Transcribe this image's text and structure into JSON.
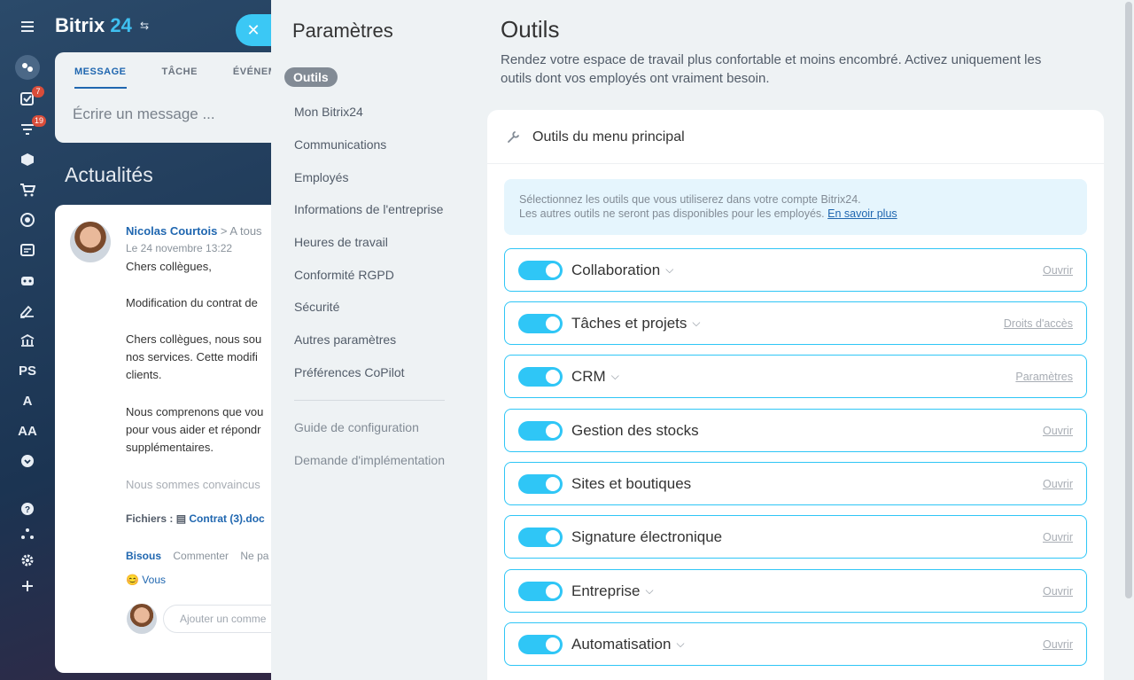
{
  "app": {
    "brand_name": "Bitrix",
    "brand_number": "24",
    "rail_badges": [
      "7",
      "19"
    ],
    "rail_text_items": [
      "PS",
      "A",
      "AA"
    ],
    "icons": [
      "menu-icon",
      "pulse-icon",
      "tasks-icon",
      "filter-icon",
      "box-icon",
      "cart-icon",
      "target-icon",
      "contact-card-icon",
      "robot-icon",
      "signature-icon",
      "bank-icon",
      "chevron-circle-icon",
      "help-icon",
      "structure-icon",
      "gear-icon",
      "plus-icon"
    ]
  },
  "feed": {
    "tabs": [
      "MESSAGE",
      "TÂCHE",
      "ÉVÉNEM"
    ],
    "compose_placeholder": "Écrire un message ...",
    "title": "Actualités",
    "post": {
      "author": "Nicolas Courtois",
      "destination": "A tous",
      "date": "Le 24 novembre 13:22",
      "lines": [
        "Chers collègues,",
        "Modification du contrat de",
        "Chers collègues, nous sou",
        "nos services. Cette modifi",
        "clients.",
        "Nous comprenons que vou",
        "pour vous aider et répondr",
        "supplémentaires.",
        "Nous sommes convaincus"
      ],
      "files_label": "Fichiers :",
      "file_name": "Contrat (3).doc",
      "actions": [
        "Bisous",
        "Commenter",
        "Ne pa"
      ],
      "reaction": "Vous",
      "comment_placeholder": "Ajouter un comme"
    }
  },
  "settings": {
    "title": "Paramètres",
    "nav": {
      "active": "Outils",
      "items": [
        "Mon Bitrix24",
        "Communications",
        "Employés",
        "Informations de l'entreprise",
        "Heures de travail",
        "Conformité RGPD",
        "Sécurité",
        "Autres paramètres",
        "Préférences CoPilot"
      ],
      "secondary": [
        "Guide de configuration",
        "Demande d'implémentation"
      ]
    },
    "content": {
      "title": "Outils",
      "description": "Rendez votre espace de travail plus confortable et moins encombré. Activez uniquement les outils dont vos employés ont vraiment besoin.",
      "card_title": "Outils du menu principal",
      "info_line1": "Sélectionnez les outils que vous utiliserez dans votre compte Bitrix24.",
      "info_line2": "Les autres outils ne seront pas disponibles pour les employés.",
      "info_link": "En savoir plus",
      "tools": [
        {
          "name": "Collaboration",
          "expandable": true,
          "action": "Ouvrir",
          "enabled": true
        },
        {
          "name": "Tâches et projets",
          "expandable": true,
          "action": "Droits d'accès",
          "enabled": true
        },
        {
          "name": "CRM",
          "expandable": true,
          "action": "Paramètres",
          "enabled": true
        },
        {
          "name": "Gestion des stocks",
          "expandable": false,
          "action": "Ouvrir",
          "enabled": true
        },
        {
          "name": "Sites et boutiques",
          "expandable": false,
          "action": "Ouvrir",
          "enabled": true
        },
        {
          "name": "Signature électronique",
          "expandable": false,
          "action": "Ouvrir",
          "enabled": true
        },
        {
          "name": "Entreprise",
          "expandable": true,
          "action": "Ouvrir",
          "enabled": true
        },
        {
          "name": "Automatisation",
          "expandable": true,
          "action": "Ouvrir",
          "enabled": true
        }
      ]
    }
  }
}
